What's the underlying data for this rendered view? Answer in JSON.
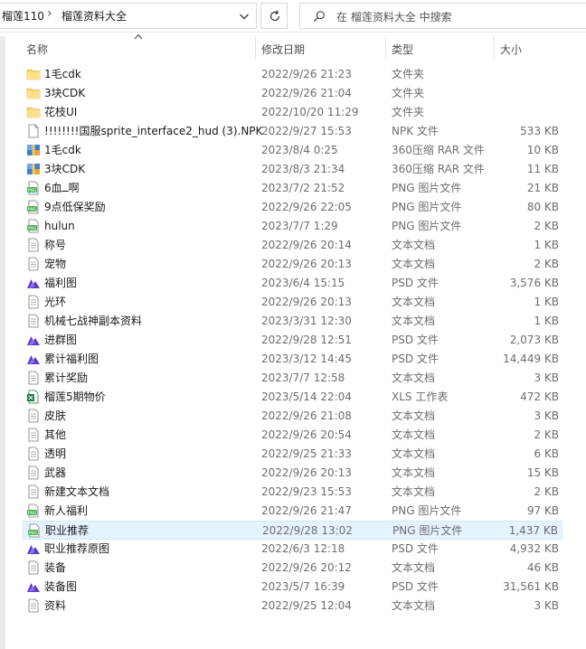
{
  "breadcrumb": {
    "items": [
      "榴莲110",
      "榴莲资料大全"
    ],
    "separator": "›"
  },
  "search": {
    "placeholder": "在 榴莲资料大全 中搜索"
  },
  "columns": {
    "name": "名称",
    "date": "修改日期",
    "type": "类型",
    "size": "大小"
  },
  "icons": {
    "folder": "folder-icon",
    "blank": "blank-file-icon",
    "rar": "rar-archive-icon",
    "png": "png-image-icon",
    "txt": "text-document-icon",
    "psd": "psd-file-icon",
    "xls": "excel-sheet-icon"
  },
  "colors": {
    "selected_bg": "#e5f3ff",
    "selected_border": "#cce8ff",
    "folder": "#f8d775",
    "png_green": "#4caf50",
    "psd_purple": "#5b3cc4"
  },
  "files": [
    {
      "name": "1毛cdk",
      "date": "2022/9/26 21:23",
      "type": "文件夹",
      "size": "",
      "icon": "folder"
    },
    {
      "name": "3块CDK",
      "date": "2022/9/26 21:04",
      "type": "文件夹",
      "size": "",
      "icon": "folder"
    },
    {
      "name": "花枝UI",
      "date": "2022/10/20 11:29",
      "type": "文件夹",
      "size": "",
      "icon": "folder"
    },
    {
      "name": "!!!!!!!!国服sprite_interface2_hud (3).NPK",
      "date": "2022/9/27 15:53",
      "type": "NPK 文件",
      "size": "533 KB",
      "icon": "blank"
    },
    {
      "name": "1毛cdk",
      "date": "2023/8/4 0:25",
      "type": "360压缩 RAR 文件",
      "size": "10 KB",
      "icon": "rar"
    },
    {
      "name": "3块CDK",
      "date": "2023/8/3 21:34",
      "type": "360压缩 RAR 文件",
      "size": "11 KB",
      "icon": "rar"
    },
    {
      "name": "6血ــ啊",
      "date": "2023/7/2 21:52",
      "type": "PNG 图片文件",
      "size": "21 KB",
      "icon": "png"
    },
    {
      "name": "9点低保奖励",
      "date": "2022/9/26 22:05",
      "type": "PNG 图片文件",
      "size": "80 KB",
      "icon": "png"
    },
    {
      "name": "hulun",
      "date": "2023/7/7 1:29",
      "type": "PNG 图片文件",
      "size": "2 KB",
      "icon": "png"
    },
    {
      "name": "称号",
      "date": "2022/9/26 20:14",
      "type": "文本文档",
      "size": "1 KB",
      "icon": "txt"
    },
    {
      "name": "宠物",
      "date": "2022/9/26 20:13",
      "type": "文本文档",
      "size": "2 KB",
      "icon": "txt"
    },
    {
      "name": "福利图",
      "date": "2023/6/4 15:15",
      "type": "PSD 文件",
      "size": "3,576 KB",
      "icon": "psd"
    },
    {
      "name": "光环",
      "date": "2022/9/26 20:13",
      "type": "文本文档",
      "size": "1 KB",
      "icon": "txt"
    },
    {
      "name": "机械七战神副本资料",
      "date": "2023/3/31 12:30",
      "type": "文本文档",
      "size": "1 KB",
      "icon": "txt"
    },
    {
      "name": "进群图",
      "date": "2022/9/28 12:51",
      "type": "PSD 文件",
      "size": "2,073 KB",
      "icon": "psd"
    },
    {
      "name": "累计福利图",
      "date": "2023/3/12 14:45",
      "type": "PSD 文件",
      "size": "14,449 KB",
      "icon": "psd"
    },
    {
      "name": "累计奖励",
      "date": "2023/7/7 12:58",
      "type": "文本文档",
      "size": "3 KB",
      "icon": "txt"
    },
    {
      "name": "榴莲5期物价",
      "date": "2023/5/14 22:04",
      "type": "XLS 工作表",
      "size": "472 KB",
      "icon": "xls"
    },
    {
      "name": "皮肤",
      "date": "2022/9/26 21:08",
      "type": "文本文档",
      "size": "3 KB",
      "icon": "txt"
    },
    {
      "name": "其他",
      "date": "2022/9/26 20:54",
      "type": "文本文档",
      "size": "2 KB",
      "icon": "txt"
    },
    {
      "name": "透明",
      "date": "2022/9/25 21:33",
      "type": "文本文档",
      "size": "6 KB",
      "icon": "txt"
    },
    {
      "name": "武器",
      "date": "2022/9/26 20:13",
      "type": "文本文档",
      "size": "15 KB",
      "icon": "txt"
    },
    {
      "name": "新建文本文档",
      "date": "2022/9/23 15:53",
      "type": "文本文档",
      "size": "2 KB",
      "icon": "txt"
    },
    {
      "name": "新人福利",
      "date": "2022/9/26 21:47",
      "type": "PNG 图片文件",
      "size": "97 KB",
      "icon": "png"
    },
    {
      "name": "职业推荐",
      "date": "2022/9/28 13:02",
      "type": "PNG 图片文件",
      "size": "1,437 KB",
      "icon": "png",
      "selected": true
    },
    {
      "name": "职业推荐原图",
      "date": "2022/6/3 12:18",
      "type": "PSD 文件",
      "size": "4,932 KB",
      "icon": "psd"
    },
    {
      "name": "装备",
      "date": "2022/9/26 20:12",
      "type": "文本文档",
      "size": "46 KB",
      "icon": "txt"
    },
    {
      "name": "装备图",
      "date": "2023/5/7 16:39",
      "type": "PSD 文件",
      "size": "31,561 KB",
      "icon": "psd"
    },
    {
      "name": "资料",
      "date": "2022/9/25 12:04",
      "type": "文本文档",
      "size": "3 KB",
      "icon": "txt"
    }
  ]
}
